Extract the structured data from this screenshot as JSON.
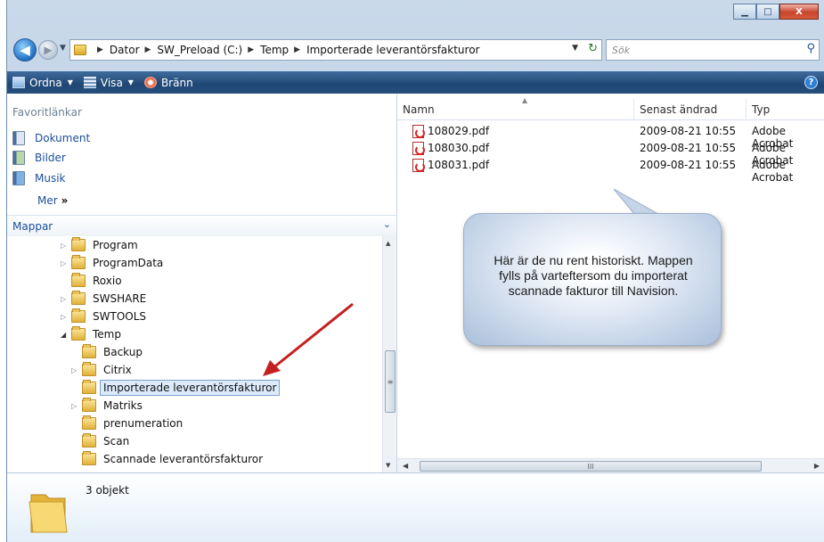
{
  "window": {
    "controls": {
      "minimize": "▁",
      "maximize": "□",
      "close": "X"
    }
  },
  "navigation": {
    "back": "◀",
    "forward": "▶",
    "history": "▼"
  },
  "address": {
    "breadcrumbs": [
      "Dator",
      "SW_Preload (C:)",
      "Temp",
      "Importerade leverantörsfakturor"
    ],
    "separator": "▶",
    "dropdown": "▼",
    "refresh": "↻"
  },
  "search": {
    "placeholder": "Sök",
    "icon": "⚲"
  },
  "toolbar": {
    "organize": "Ordna",
    "views": "Visa",
    "burn": "Bränn",
    "dropdown": "▼",
    "help": "?"
  },
  "favorites": {
    "header": "Favoritlänkar",
    "items": [
      "Dokument",
      "Bilder",
      "Musik"
    ],
    "more": "Mer",
    "more_chevron": "»"
  },
  "folders": {
    "header": "Mappar",
    "chevron": "⌄",
    "expand_arrow": "▷",
    "collapse_arrow": "◢",
    "tree": [
      "Program",
      "ProgramData",
      "Roxio",
      "SWSHARE",
      "SWTOOLS",
      "Temp",
      "Backup",
      "Citrix",
      "Importerade leverantörsfakturor",
      "Matriks",
      "prenumeration",
      "Scan",
      "Scannade leverantörsfakturor"
    ]
  },
  "columns": {
    "name": "Namn",
    "modified": "Senast ändrad",
    "type": "Typ",
    "sort_arrow": "▲"
  },
  "files": [
    {
      "name": "108029.pdf",
      "modified": "2009-08-21 10:55",
      "type": "Adobe Acrobat"
    },
    {
      "name": "108030.pdf",
      "modified": "2009-08-21 10:55",
      "type": "Adobe Acrobat"
    },
    {
      "name": "108031.pdf",
      "modified": "2009-08-21 10:55",
      "type": "Adobe Acrobat"
    }
  ],
  "scrollbars": {
    "up": "▲",
    "down": "▼",
    "left": "◀",
    "right": "▶",
    "grip_v": "≡",
    "grip_h": "III"
  },
  "callout": {
    "text": "Här är de nu rent historiskt. Mappen fylls på varteftersom du importerat scannade fakturor till Navision."
  },
  "details": {
    "count": "3 objekt"
  }
}
